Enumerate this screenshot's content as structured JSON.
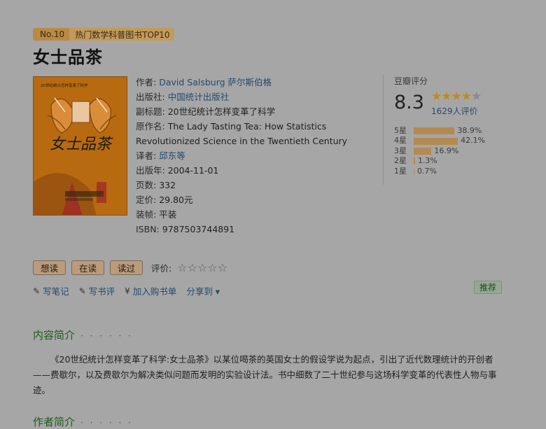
{
  "rank": {
    "no": "No.10",
    "text": "热门数学科普图书TOP10"
  },
  "title": "女士品茶",
  "cover": {
    "top_text": "20世纪统计怎样变革了科学",
    "calligraphy": "女士品茶",
    "colors": {
      "bg": "#b86a10",
      "frame": "#c08a1c"
    }
  },
  "info": {
    "author_label": "作者:",
    "author": "David Salsburg 萨尔斯伯格",
    "publisher_label": "出版社:",
    "publisher": "中国统计出版社",
    "subtitle_label": "副标题:",
    "subtitle": "20世纪统计怎样变革了科学",
    "original_label": "原作名:",
    "original": "The Lady Tasting Tea: How Statistics Revolutionized Science in the Twentieth Century",
    "translator_label": "译者:",
    "translator": "邱东等",
    "year_label": "出版年:",
    "year": "2004-11-01",
    "pages_label": "页数:",
    "pages": "332",
    "price_label": "定价:",
    "price": "29.80元",
    "binding_label": "装帧:",
    "binding": "平装",
    "isbn_label": "ISBN:",
    "isbn": "9787503744891"
  },
  "rating": {
    "title": "豆瓣评分",
    "score": "8.3",
    "stars": 4,
    "votes": "1629人评价",
    "distribution": [
      {
        "label": "5星",
        "percent": 38.9,
        "text": "38.9%"
      },
      {
        "label": "4星",
        "percent": 42.1,
        "text": "42.1%"
      },
      {
        "label": "3星",
        "percent": 16.9,
        "text": "16.9%"
      },
      {
        "label": "2星",
        "percent": 1.3,
        "text": "1.3%"
      },
      {
        "label": "1星",
        "percent": 0.7,
        "text": "0.7%"
      }
    ]
  },
  "actions": {
    "want": "想读",
    "reading": "在读",
    "read": "读过",
    "rate_label": "评价:",
    "rate_stars": "☆☆☆☆☆"
  },
  "links": {
    "note": "写笔记",
    "review": "写书评",
    "cart": "加入购书单",
    "share": "分享到 ▾"
  },
  "recommend": "推荐",
  "intro": {
    "title": "内容简介",
    "dots": "· · · · · ·",
    "text": "《20世纪统计怎样变革了科学:女士品茶》以某位喝茶的英国女士的假设学说为起点，引出了近代数理统计的开创者——费歇尔，以及费歇尔为解决类似问题而发明的实验设计法。书中细数了二十世纪参与这场科学变革的代表性人物与事迹。"
  },
  "author_intro": {
    "title": "作者简介",
    "dots": "· · · · · ·"
  },
  "colors": {
    "accent_link": "#234a6e",
    "star": "#c08a1c",
    "section": "#1f5c1f"
  }
}
